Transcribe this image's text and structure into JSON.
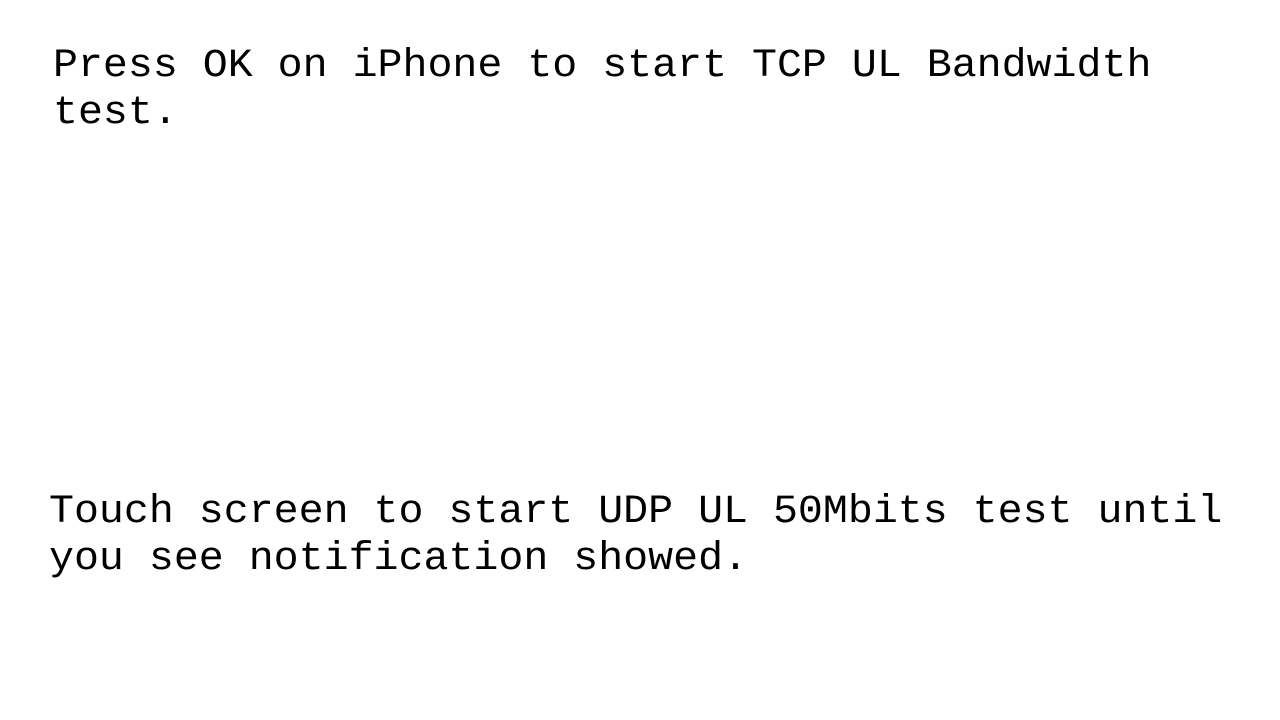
{
  "instructions": {
    "tcp_prompt": "Press OK on iPhone to start TCP UL Bandwidth\ntest.",
    "udp_prompt": "Touch screen to start UDP UL 50Mbits test until\nyou see notification showed."
  },
  "colors": {
    "background": "#ffffff",
    "text": "#000000"
  }
}
